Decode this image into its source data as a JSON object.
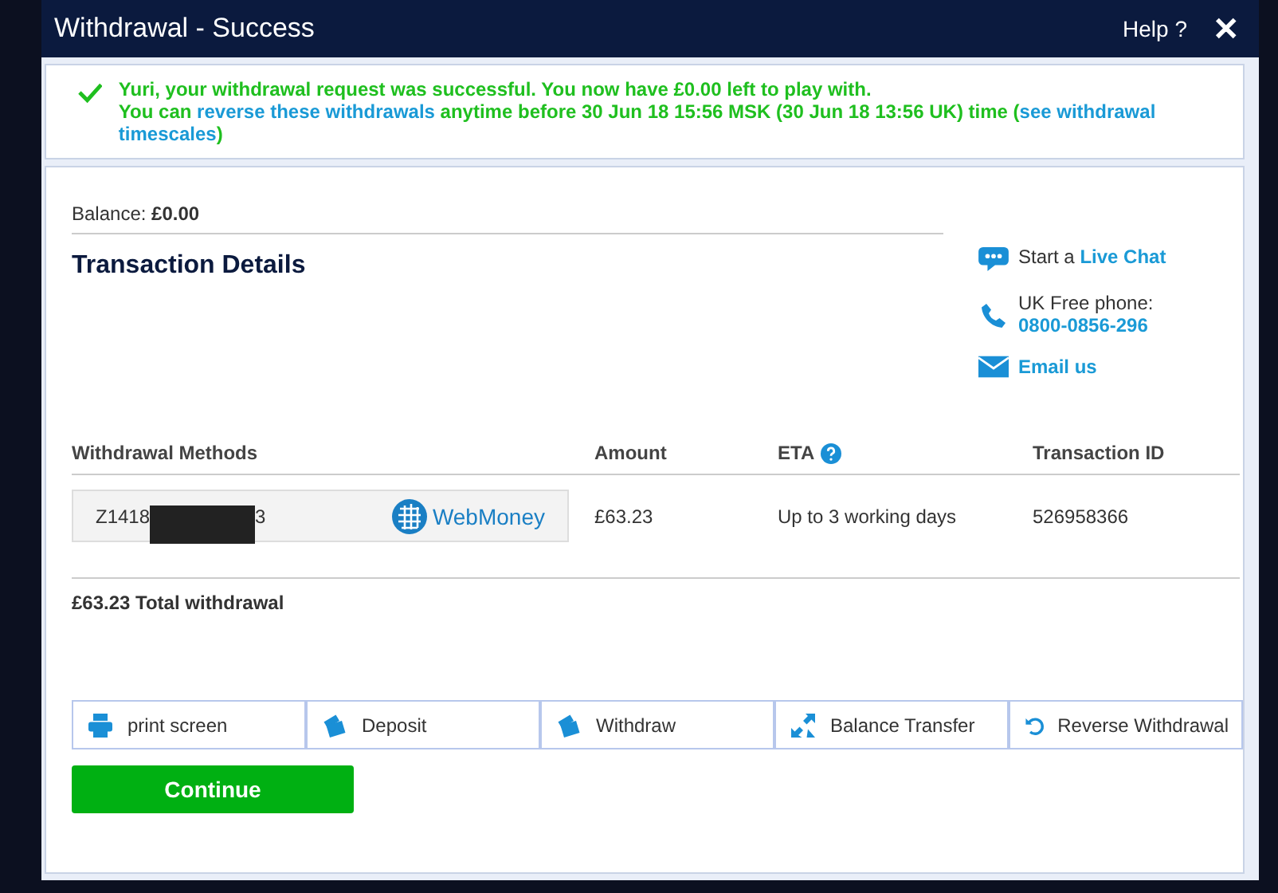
{
  "window": {
    "title": "Withdrawal - Success",
    "help": "Help ?",
    "close": "✕"
  },
  "notice": {
    "line1": "Yuri, your withdrawal request was successful. You now have £0.00 left to play with.",
    "line2_start": "You can ",
    "reverse_link": "reverse these withdrawals",
    "line2_mid": " anytime before 30 Jun 18 15:56 MSK (30 Jun 18 13:56 UK) time (",
    "timescales_link": [
      "see withdrawal",
      "timescales"
    ],
    "line2_end": ")"
  },
  "balance": {
    "label": "Balance:",
    "value": "£0.00"
  },
  "section_title": "Transaction Details",
  "contact": {
    "chat_prefix": "Start a ",
    "chat_link": "Live Chat",
    "phone_label": "UK Free phone:",
    "phone_number": "0800-0856-296",
    "email": "Email us"
  },
  "table": {
    "columns": [
      "Withdrawal Methods",
      "Amount",
      "ETA",
      "Transaction ID"
    ],
    "rows": [
      {
        "method_start": "Z1418",
        "method_end": "3",
        "redacted": true,
        "provider": "WebMoney",
        "amount": "£63.23",
        "eta": "Up to 3 working days",
        "transaction_id": "526958366"
      }
    ]
  },
  "total": "£63.23 Total withdrawal",
  "actions": [
    {
      "kind": "print",
      "label": "print screen"
    },
    {
      "kind": "deposit",
      "label": "Deposit"
    },
    {
      "kind": "withdraw",
      "label": "Withdraw"
    },
    {
      "kind": "transfer",
      "label": "Balance Transfer"
    },
    {
      "kind": "reverse",
      "label": "Reverse Withdrawal"
    }
  ],
  "continue_button": "Continue"
}
